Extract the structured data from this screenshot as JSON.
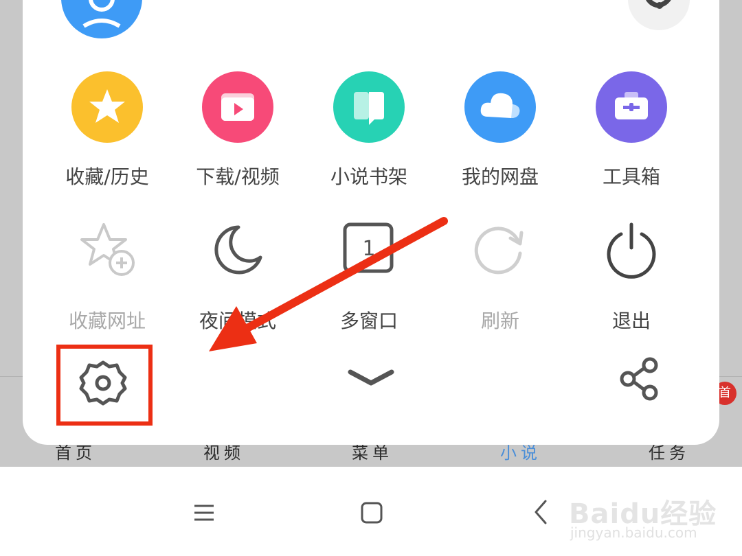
{
  "menu": {
    "row1": [
      {
        "label": "收藏/历史",
        "icon": "star-icon",
        "color": "#fbc02d"
      },
      {
        "label": "下载/视频",
        "icon": "folder-play-icon",
        "color": "#f74a78"
      },
      {
        "label": "小说书架",
        "icon": "book-icon",
        "color": "#27d2b4"
      },
      {
        "label": "我的网盘",
        "icon": "cloud-icon",
        "color": "#3e9bf6"
      },
      {
        "label": "工具箱",
        "icon": "toolbox-icon",
        "color": "#7a67e8"
      }
    ],
    "row2": [
      {
        "label": "收藏网址",
        "icon": "bookmark-add-icon",
        "disabled": true
      },
      {
        "label": "夜间模式",
        "icon": "moon-icon",
        "disabled": false
      },
      {
        "label": "多窗口",
        "icon": "multi-window-icon",
        "window_count": "1",
        "disabled": false
      },
      {
        "label": "刷新",
        "icon": "refresh-icon",
        "disabled": true
      },
      {
        "label": "退出",
        "icon": "power-icon",
        "disabled": false
      }
    ]
  },
  "bottom_tabs": [
    {
      "label": "首页"
    },
    {
      "label": "视频"
    },
    {
      "label": "菜单"
    },
    {
      "label": "小说",
      "active": true
    },
    {
      "label": "任务"
    }
  ],
  "badge_text": "首",
  "watermark": {
    "main": "Baidu经验",
    "sub": "jingyan.baidu.com"
  },
  "colors": {
    "annotation": "#ec2f14",
    "active_tab": "#4a8ed8"
  }
}
